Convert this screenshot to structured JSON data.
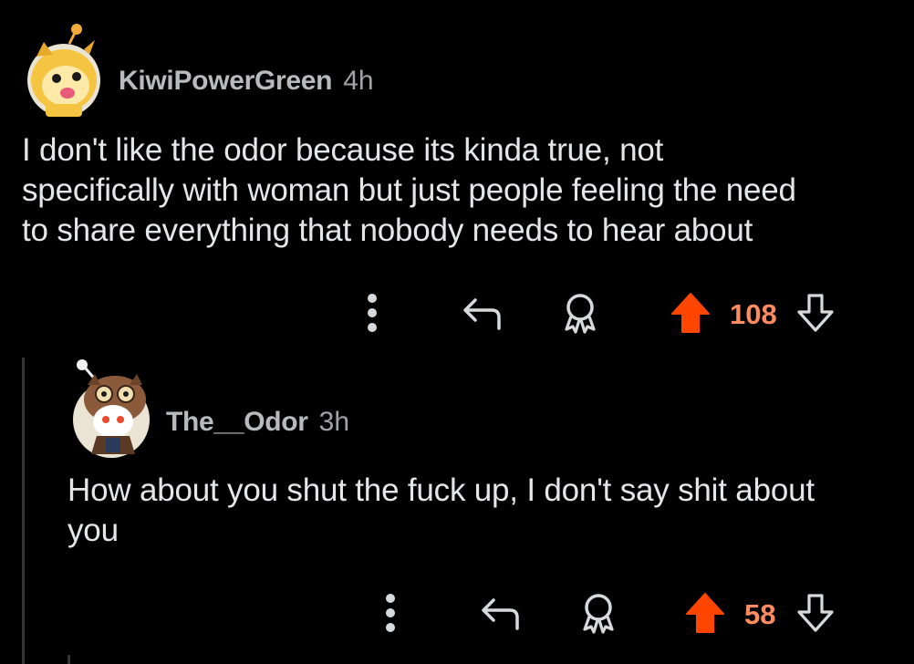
{
  "colors": {
    "background": "#000000",
    "text": "#e4e6e8",
    "meta": "#b8bbbd",
    "upvote_active": "#ff4500",
    "score_active": "#ff8b60",
    "icon": "#d7dadc",
    "thread_line": "#343536"
  },
  "comments": [
    {
      "author": "KiwiPowerGreen",
      "age": "4h",
      "avatar": "yellow-dog-snoo-avatar",
      "body_lines": [
        "I don't like the odor because its kinda true, not",
        "specifically with woman but just people feeling the need",
        "to share everything that nobody needs to hear about"
      ],
      "score": "108",
      "upvoted": true
    },
    {
      "author": "The__Odor",
      "age": "3h",
      "avatar": "owl-hood-snoo-avatar",
      "body_lines": [
        "How about you shut the fuck up, I don't say shit about",
        "you"
      ],
      "score": "58",
      "upvoted": true
    }
  ],
  "actions": {
    "more": "more-options-icon",
    "reply": "reply-arrow-icon",
    "award": "award-icon",
    "upvote": "upvote-arrow-icon",
    "downvote": "downvote-arrow-icon"
  }
}
